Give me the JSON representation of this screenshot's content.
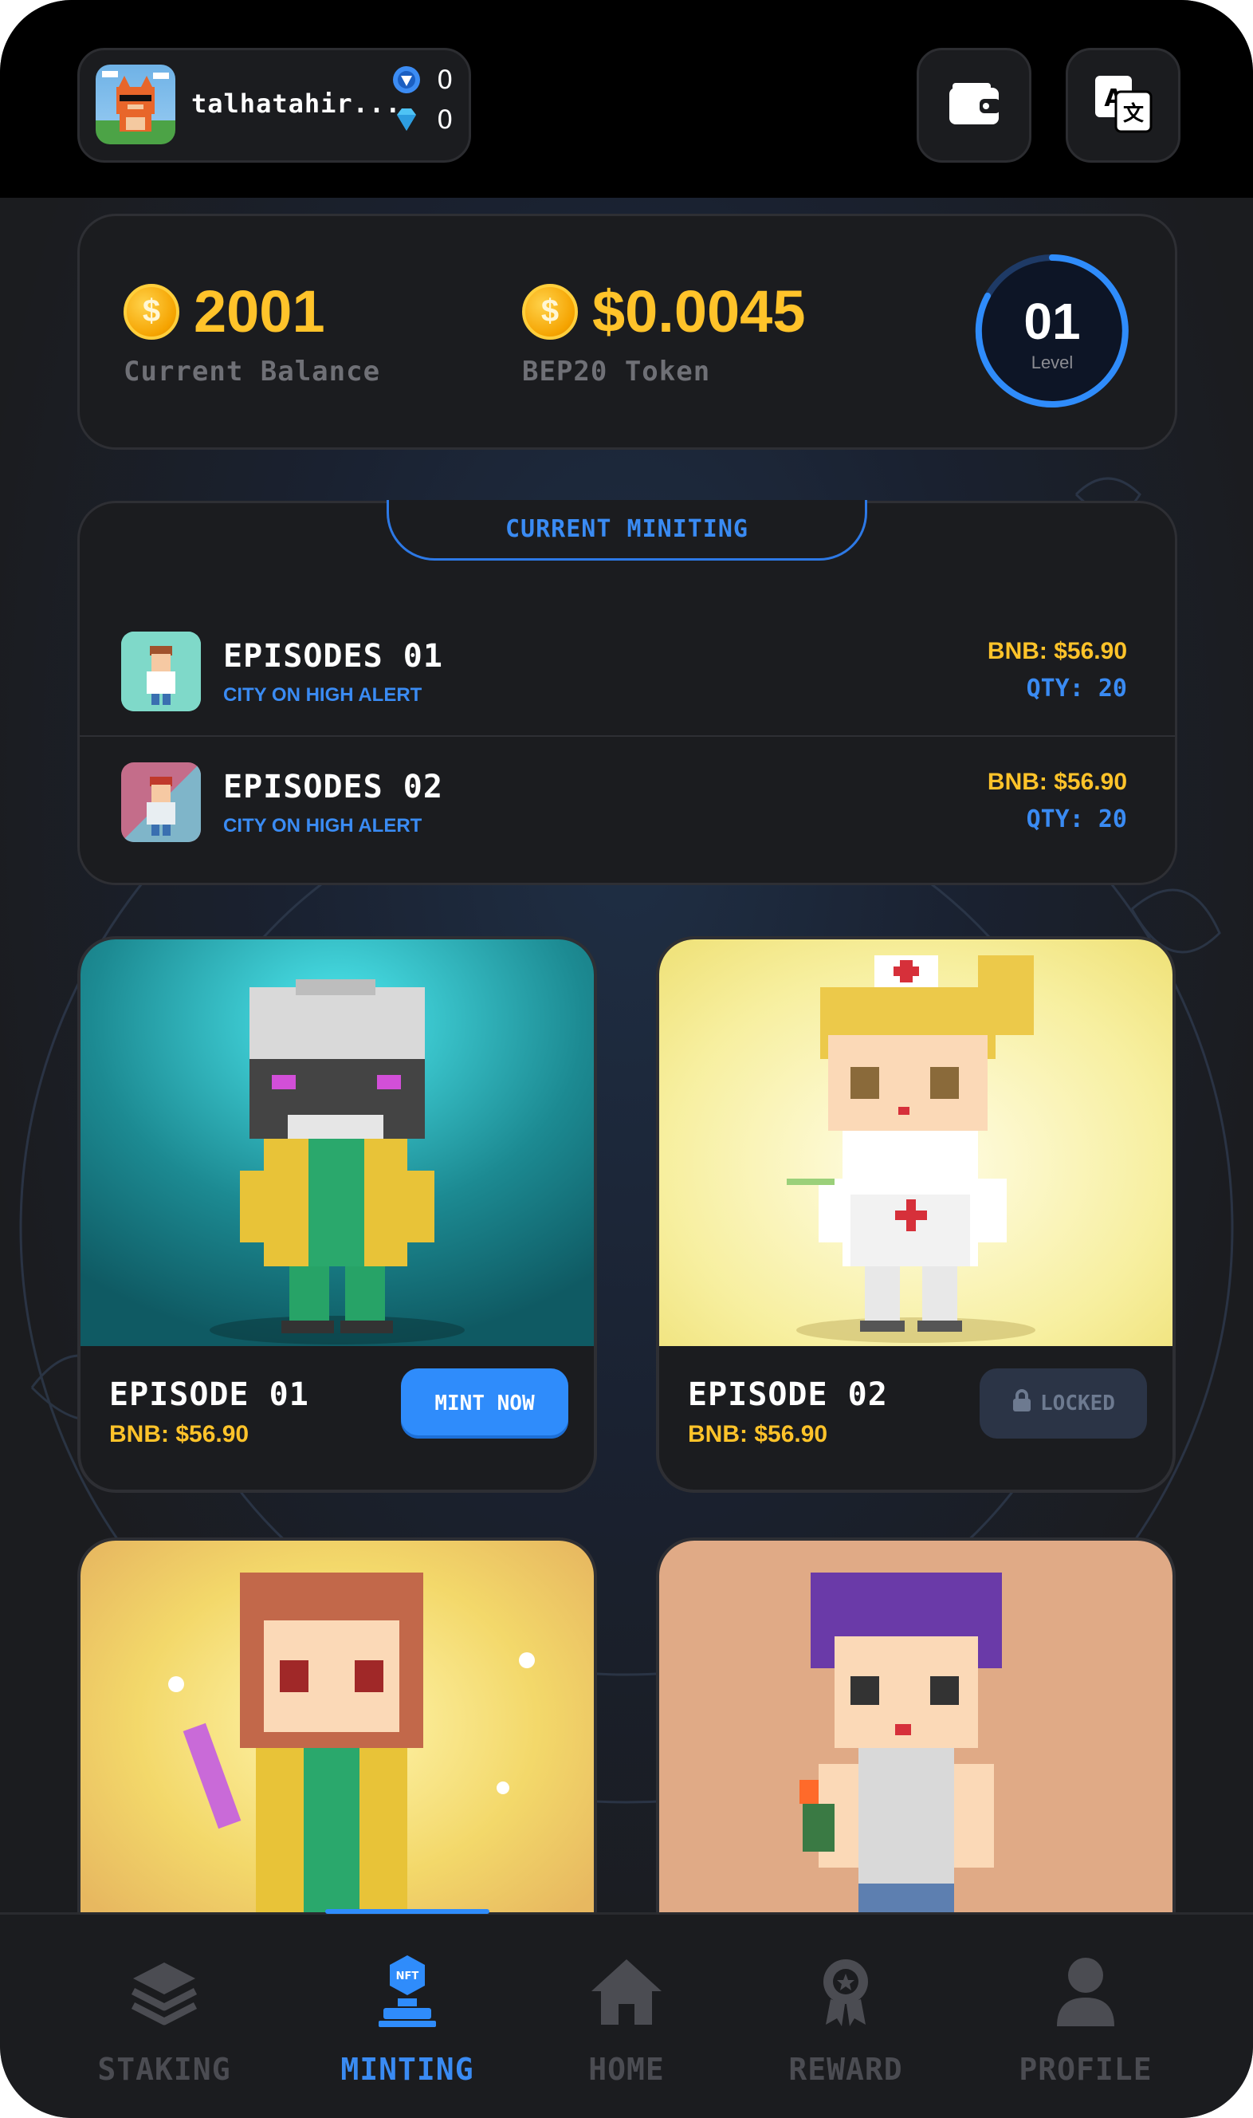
{
  "header": {
    "username": "talhatahir...",
    "token_count": "0",
    "gem_count": "0",
    "wallet_icon": "wallet-icon",
    "translate_icon": "translate-icon"
  },
  "balance": {
    "current_value": "2001",
    "current_label": "Current Balance",
    "token_value": "$0.0045",
    "token_label": "BEP20 Token",
    "level_value": "01",
    "level_label": "Level"
  },
  "minting_list": {
    "tab_label": "CURRENT MINITING",
    "episodes": [
      {
        "title": "EPISODES 01",
        "subtitle": "CITY ON HIGH ALERT",
        "price": "BNB: $56.90",
        "qty": "QTY: 20"
      },
      {
        "title": "EPISODES 02",
        "subtitle": "CITY ON HIGH ALERT",
        "price": "BNB: $56.90",
        "qty": "QTY: 20"
      }
    ]
  },
  "nft_cards": [
    {
      "title": "EPISODE 01",
      "price": "BNB: $56.90",
      "action": "MINT NOW",
      "state": "available"
    },
    {
      "title": "EPISODE 02",
      "price": "BNB: $56.90",
      "action": "LOCKED",
      "state": "locked"
    }
  ],
  "nav": {
    "items": [
      {
        "label": "STAKING",
        "icon": "layers-icon"
      },
      {
        "label": "MINTING",
        "icon": "nft-mint-icon",
        "active": true
      },
      {
        "label": "HOME",
        "icon": "home-icon"
      },
      {
        "label": "REWARD",
        "icon": "award-icon"
      },
      {
        "label": "PROFILE",
        "icon": "user-icon"
      }
    ]
  },
  "colors": {
    "accent_blue": "#2f8cfb",
    "gold": "#ffc32a",
    "background": "#1b1c1f"
  }
}
